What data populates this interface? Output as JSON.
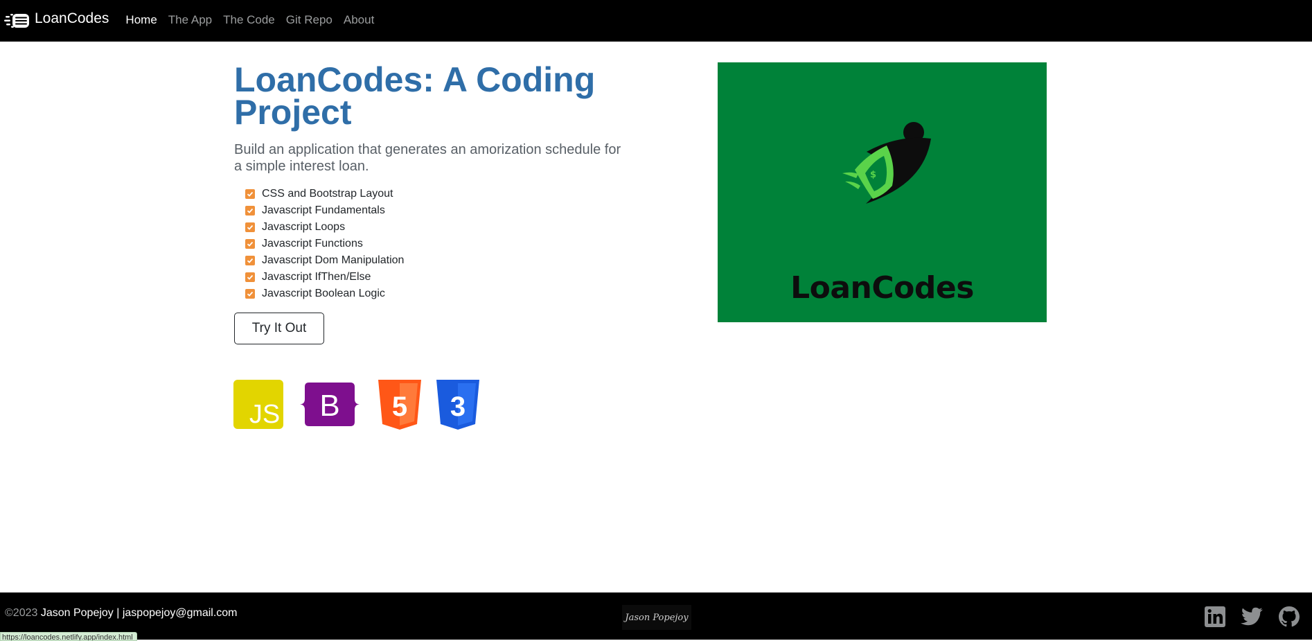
{
  "brand": {
    "name": "LoanCodes",
    "icon": "dollar-dash-icon"
  },
  "nav": {
    "items": [
      {
        "label": "Home",
        "active": true
      },
      {
        "label": "The App",
        "active": false
      },
      {
        "label": "The Code",
        "active": false
      },
      {
        "label": "Git Repo",
        "active": false
      },
      {
        "label": "About",
        "active": false
      }
    ]
  },
  "hero": {
    "title": "LoanCodes: A Coding Project",
    "lead": "Build an application that generates an amorization schedule for a simple interest loan.",
    "checklist": [
      "CSS and Bootstrap Layout",
      "Javascript Fundamentals",
      "Javascript Loops",
      "Javascript Functions",
      "Javascript Dom Manipulation",
      "Javascript IfThen/Else",
      "Javascript Boolean Logic"
    ],
    "button_label": "Try It Out",
    "tech_icons": [
      {
        "name": "javascript-icon",
        "label": "JS"
      },
      {
        "name": "bootstrap-icon",
        "label": "B"
      },
      {
        "name": "html5-icon",
        "label": "5"
      },
      {
        "name": "css3-icon",
        "label": "3"
      }
    ],
    "image": {
      "text": "LoanCodes",
      "background": "#008239",
      "accent": "#5ad34a"
    }
  },
  "footer": {
    "year": "©2023",
    "author": "Jason Popejoy | jaspopejoy@gmail.com",
    "signature": "Jason Popejoy",
    "socials": [
      "linkedin-icon",
      "twitter-icon",
      "github-icon"
    ]
  },
  "status_bar": {
    "url": "https://loancodes.netlify.app/index.html"
  },
  "colors": {
    "title": "#2f6ea8",
    "checkbox": "#f0913a",
    "navbar": "#000000",
    "js": "#e2d500",
    "bootstrap": "#7e0f8e",
    "html5": "#ff5717",
    "css3": "#1a5bde"
  }
}
